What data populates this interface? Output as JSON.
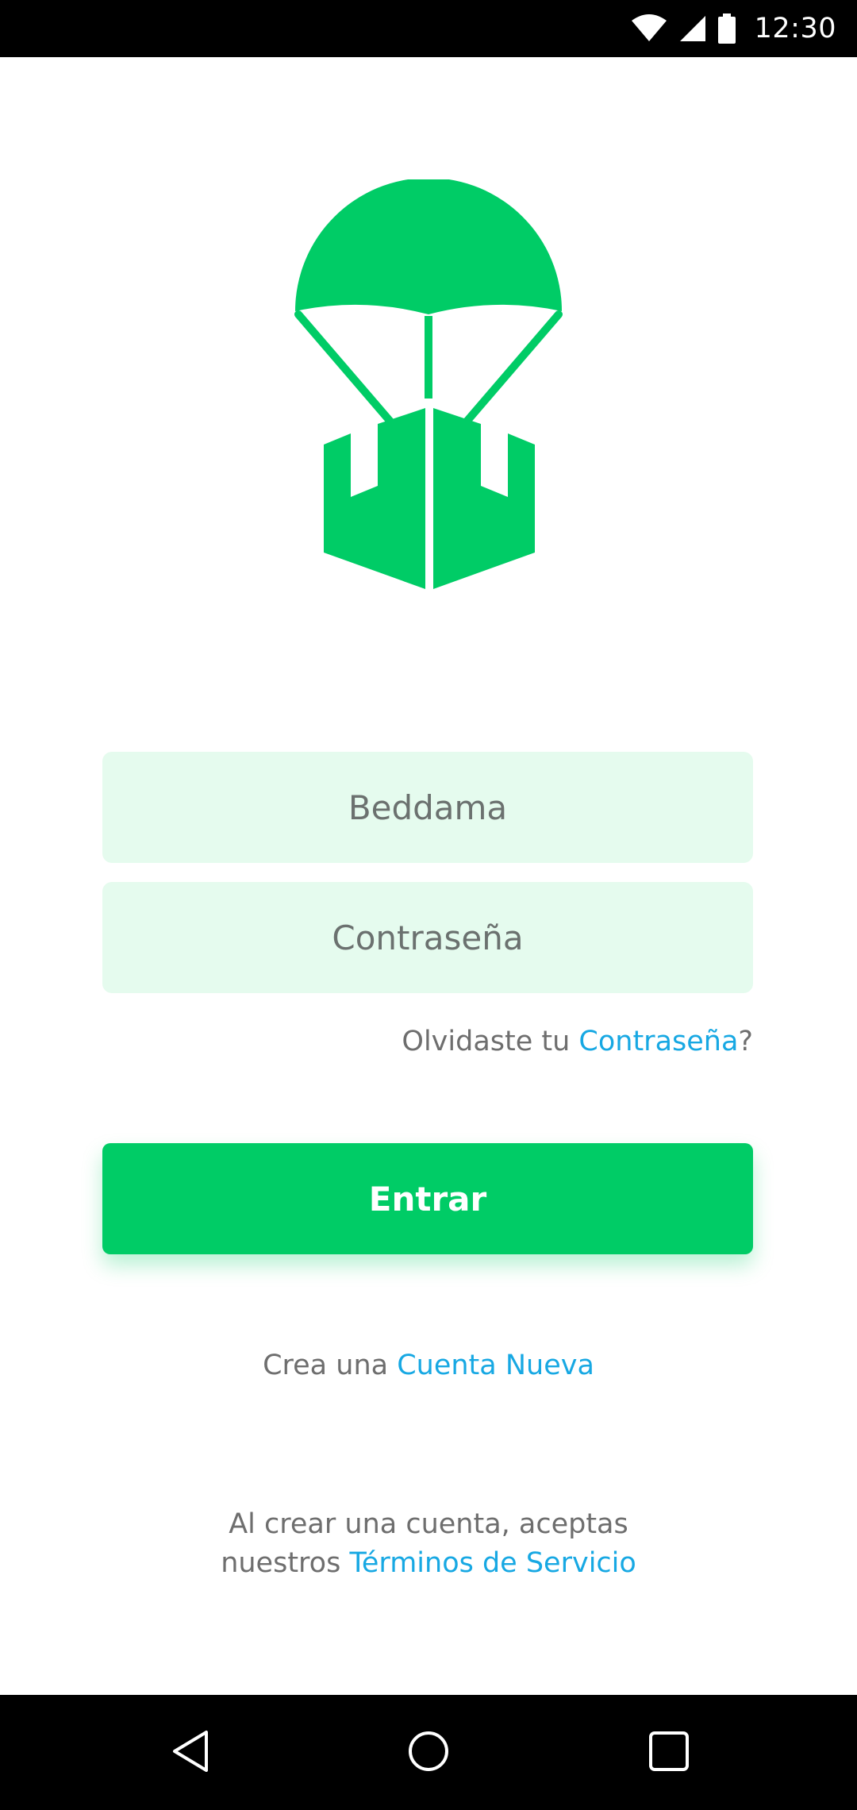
{
  "status_bar": {
    "time": "12:30",
    "icons": [
      "wifi-icon",
      "cell-signal-icon",
      "battery-icon"
    ]
  },
  "logo": {
    "icon": "parachute-box-icon",
    "color": "#00cc66"
  },
  "form": {
    "username_placeholder": "Beddama",
    "password_placeholder": "Contraseña",
    "forgot_prefix": "Olvidaste tu ",
    "forgot_link": "Contraseña",
    "forgot_suffix": "?",
    "submit_label": "Entrar"
  },
  "signup": {
    "prefix": "Crea una ",
    "link": "Cuenta Nueva"
  },
  "terms": {
    "line1": "Al crear una cuenta, aceptas",
    "line2_prefix": "nuestros ",
    "link": "Términos de Servicio"
  },
  "nav_bar": {
    "icons": [
      "back-icon",
      "home-icon",
      "recents-icon"
    ]
  },
  "colors": {
    "accent": "#00cc66",
    "field_bg": "#e5fbee",
    "link": "#17a8e3",
    "text_muted": "#6e6e6e"
  }
}
